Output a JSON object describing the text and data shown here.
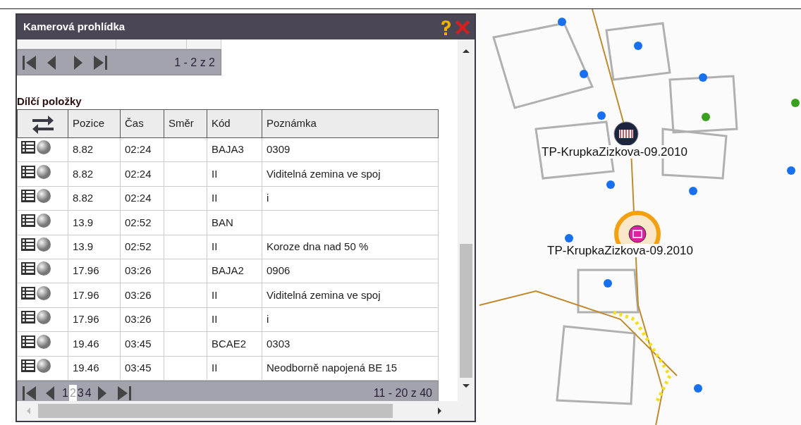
{
  "window": {
    "title": "Kamerová prohlídka"
  },
  "inspections_pager": {
    "range": "1 - 2 z 2"
  },
  "section_title": "Dílčí položky",
  "table": {
    "columns": [
      "Pozice",
      "Čas",
      "Směr",
      "Kód",
      "Poznámka"
    ],
    "rows": [
      {
        "cells": [
          "8.82",
          "02:24",
          "",
          "BAJA3",
          "0309"
        ]
      },
      {
        "cells": [
          "8.82",
          "02:24",
          "",
          "II",
          "Viditelná zemina ve spoj"
        ]
      },
      {
        "cells": [
          "8.82",
          "02:24",
          "",
          "II",
          "i"
        ]
      },
      {
        "cells": [
          "13.9",
          "02:52",
          "",
          "BAN",
          ""
        ]
      },
      {
        "cells": [
          "13.9",
          "02:52",
          "",
          "II",
          "Koroze dna nad 50 %"
        ]
      },
      {
        "cells": [
          "17.96",
          "03:26",
          "",
          "BAJA2",
          "0906"
        ]
      },
      {
        "cells": [
          "17.96",
          "03:26",
          "",
          "II",
          "Viditelná zemina ve spoj"
        ]
      },
      {
        "cells": [
          "17.96",
          "03:26",
          "",
          "II",
          "i"
        ]
      },
      {
        "cells": [
          "19.46",
          "03:45",
          "",
          "BCAE2",
          "0303"
        ]
      },
      {
        "cells": [
          "19.46",
          "03:45",
          "",
          "II",
          "Neodborně napojená BE 15"
        ]
      }
    ]
  },
  "pager": {
    "pages": [
      {
        "label": "1",
        "selected": false
      },
      {
        "label": "2",
        "selected": true
      },
      {
        "label": "3",
        "selected": false
      },
      {
        "label": "4",
        "selected": false
      }
    ],
    "range": "11 - 20 z 40"
  },
  "map": {
    "markers": [
      {
        "label": "TP-KrupkaZizkova-09.2010",
        "kind": "camera"
      },
      {
        "label": "TP-KrupkaZizkova-09.2010",
        "kind": "highlighted"
      }
    ]
  }
}
